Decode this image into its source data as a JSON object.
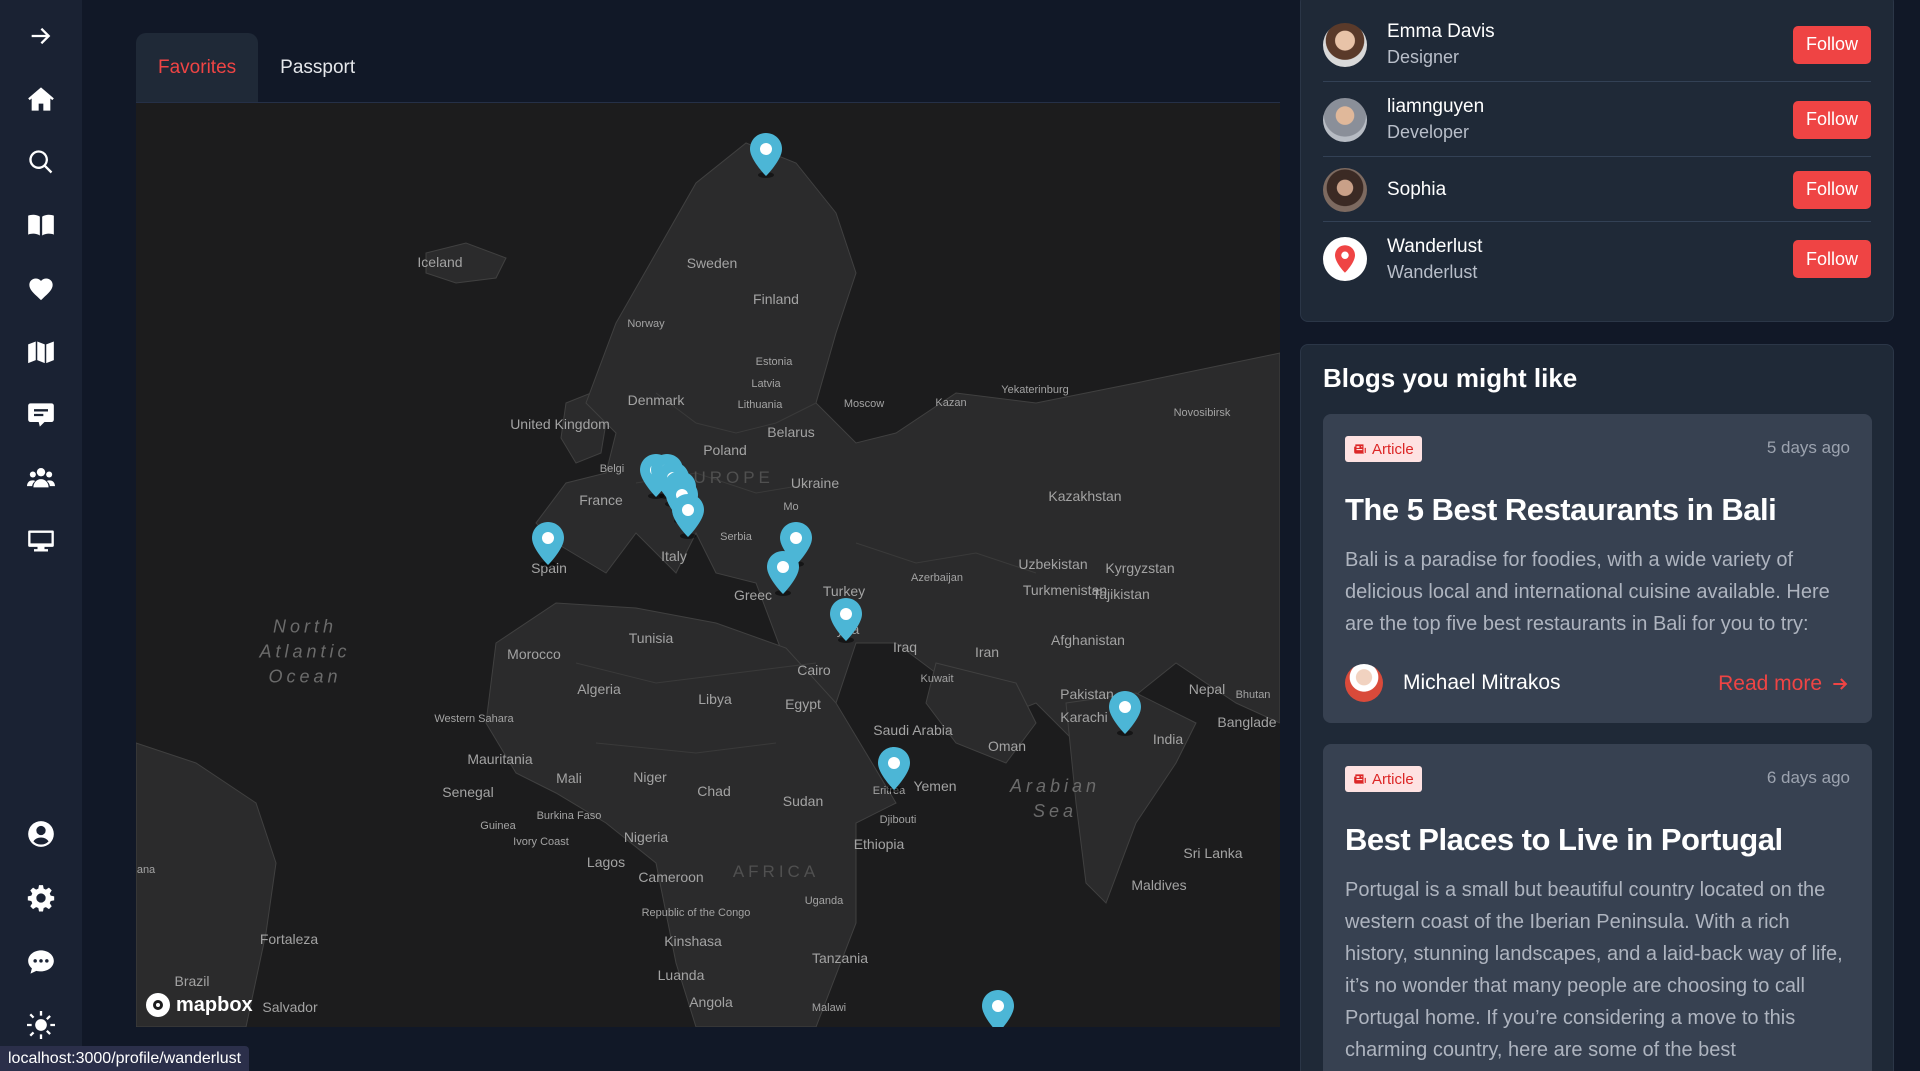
{
  "sidebar": {
    "items": [
      {
        "icon": "arrow-right-icon"
      },
      {
        "icon": "home-icon"
      },
      {
        "icon": "search-icon"
      },
      {
        "icon": "book-open-icon"
      },
      {
        "icon": "heart-icon"
      },
      {
        "icon": "map-icon"
      },
      {
        "icon": "comment-icon"
      },
      {
        "icon": "users-icon"
      },
      {
        "icon": "monitor-icon"
      },
      {
        "icon": "user-circle-icon"
      },
      {
        "icon": "gear-icon"
      },
      {
        "icon": "chat-bubble-icon"
      },
      {
        "icon": "sun-icon"
      }
    ]
  },
  "tabs": [
    {
      "label": "Favorites",
      "active": true
    },
    {
      "label": "Passport",
      "active": false
    }
  ],
  "map": {
    "pin_color": "#4cb6d6",
    "labels": [
      {
        "text": "Iceland"
      },
      {
        "text": "Sweden"
      },
      {
        "text": "Finland"
      },
      {
        "text": "Norway"
      },
      {
        "text": "Estonia"
      },
      {
        "text": "Latvia"
      },
      {
        "text": "Lithuania"
      },
      {
        "text": "Denmark"
      },
      {
        "text": "United\nKingdom"
      },
      {
        "text": "Moscow"
      },
      {
        "text": "Kazan"
      },
      {
        "text": "Yekaterinburg"
      },
      {
        "text": "Novosibirsk"
      },
      {
        "text": "Belarus"
      },
      {
        "text": "Poland"
      },
      {
        "text": "Belgi"
      },
      {
        "text": "EUROPE"
      },
      {
        "text": "Ukraine"
      },
      {
        "text": "France"
      },
      {
        "text": "ria"
      },
      {
        "text": "Kazakhstan"
      },
      {
        "text": "Mo"
      },
      {
        "text": "Serbia"
      },
      {
        "text": "North\nAtlantic\nOcean"
      },
      {
        "text": "Spain"
      },
      {
        "text": "Italy"
      },
      {
        "text": "Azerbaijan"
      },
      {
        "text": "Uzbekistan"
      },
      {
        "text": "Kyrgyzstan"
      },
      {
        "text": "Turkmenistan"
      },
      {
        "text": "Tajikistan"
      },
      {
        "text": "Greec"
      },
      {
        "text": "Turkey"
      },
      {
        "text": "yria"
      },
      {
        "text": "Tunisia"
      },
      {
        "text": "Iraq"
      },
      {
        "text": "Iran"
      },
      {
        "text": "Afghanistan"
      },
      {
        "text": "Morocco"
      },
      {
        "text": "Cairo"
      },
      {
        "text": "Kuwait"
      },
      {
        "text": "Algeria"
      },
      {
        "text": "Libya"
      },
      {
        "text": "Egypt"
      },
      {
        "text": "Pakistan"
      },
      {
        "text": "Nepal"
      },
      {
        "text": "Bhutan"
      },
      {
        "text": "Karachi"
      },
      {
        "text": "Banglade"
      },
      {
        "text": "Western\nSahara"
      },
      {
        "text": "Saudi Arabia"
      },
      {
        "text": "Oman"
      },
      {
        "text": "India"
      },
      {
        "text": "Mauritania"
      },
      {
        "text": "Mali"
      },
      {
        "text": "Niger"
      },
      {
        "text": "Chad"
      },
      {
        "text": "Arabian\nSea"
      },
      {
        "text": "Senegal"
      },
      {
        "text": "Sudan"
      },
      {
        "text": "Eritrea"
      },
      {
        "text": "Yemen"
      },
      {
        "text": "Burkina Faso"
      },
      {
        "text": "Guinea"
      },
      {
        "text": "Djibouti"
      },
      {
        "text": "Nigeria"
      },
      {
        "text": "Ivory Coast"
      },
      {
        "text": "Ethiopia"
      },
      {
        "text": "Sri Lanka"
      },
      {
        "text": "Lagos"
      },
      {
        "text": "ana"
      },
      {
        "text": "AFRICA"
      },
      {
        "text": "Cameroon"
      },
      {
        "text": "Maldives"
      },
      {
        "text": "Uganda"
      },
      {
        "text": "Republic of\nthe Congo"
      },
      {
        "text": "Kinshasa"
      },
      {
        "text": "Fortaleza"
      },
      {
        "text": "Tanzania"
      },
      {
        "text": "Luanda"
      },
      {
        "text": "Brazil"
      },
      {
        "text": "Angola"
      },
      {
        "text": "Malawi"
      },
      {
        "text": "Salvador"
      }
    ],
    "attribution": "mapbox"
  },
  "follow": {
    "users": [
      {
        "name": "Emma Davis",
        "role": "Designer",
        "button": "Follow",
        "avatar": "photo"
      },
      {
        "name": "liamnguyen",
        "role": "Developer",
        "button": "Follow",
        "avatar": "photo"
      },
      {
        "name": "Sophia",
        "role": "",
        "button": "Follow",
        "avatar": "photo"
      },
      {
        "name": "Wanderlust",
        "role": "Wanderlust",
        "button": "Follow",
        "avatar": "location-pin-logo"
      }
    ]
  },
  "blogs": {
    "title": "Blogs you might like",
    "items": [
      {
        "badge": "Article",
        "time": "5 days ago",
        "title": "The 5 Best Restaurants in Bali",
        "excerpt": "Bali is a paradise for foodies, with a wide variety of delicious local and international cuisine available. Here are the top five best restaurants in Bali for you to try:",
        "author": "Michael Mitrakos",
        "read_more": "Read more"
      },
      {
        "badge": "Article",
        "time": "6 days ago",
        "title": "Best Places to Live in Portugal",
        "excerpt": "Portugal is a small but beautiful country located on the western coast of the Iberian Peninsula. With a rich history, stunning landscapes, and a laid-back way of life, it’s no wonder that many people are choosing to call Portugal home. If you’re considering a move to this charming country, here are some of the best",
        "author": "",
        "read_more": ""
      }
    ]
  },
  "status_bar": {
    "url": "localhost:3000/profile/wanderlust"
  },
  "colors": {
    "accent": "#ef4444",
    "background": "#111827",
    "card": "#1f2937",
    "blog_card": "#374151",
    "map_bg": "#1c1c1d"
  }
}
